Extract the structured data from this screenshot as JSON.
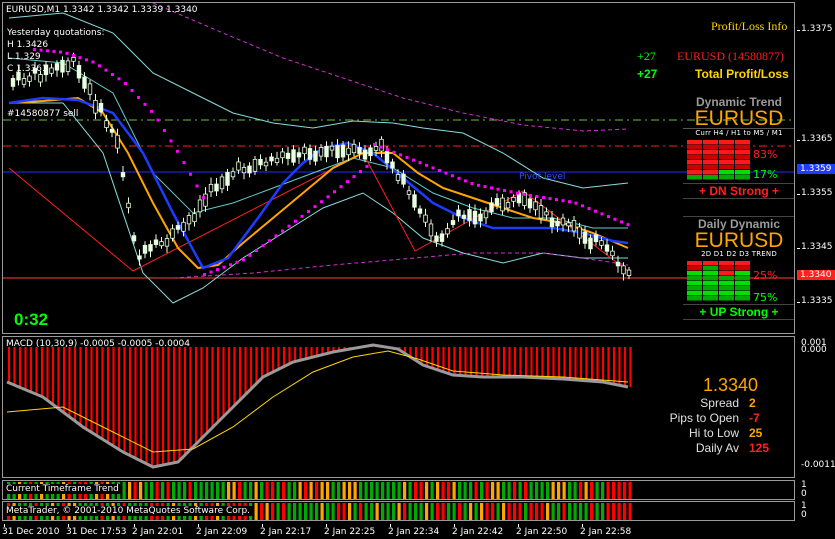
{
  "chart_header": {
    "symbol_line": "EURUSD,M1  1.3342 1.3342 1.3339 1.3340",
    "yesterday_title": "Yesterday quotations:",
    "yesterday_high": "H 1.3426",
    "yesterday_low": "L 1.329",
    "yesterday_close": "C 1.3361",
    "order_label": "#14580877 sell",
    "countdown": "0:32",
    "pivot_label": "Pivot level"
  },
  "profit_loss": {
    "title": "Profit/Loss Info",
    "order_value": "+27",
    "order_label": "EURUSD (14580877)",
    "total_value": "+27",
    "total_label": "Total Profit/Loss"
  },
  "dynamic_trend": {
    "title": "Dynamic Trend",
    "symbol": "EURUSD",
    "columns": "Curr  H4 / H1  to  M5 / M1",
    "down_pct": "83%",
    "up_pct": "17%",
    "signal": "+  DN Strong  +",
    "bar_colors": [
      "#cc0000",
      "#ff0000",
      "#00aa00",
      "#00ff00"
    ]
  },
  "daily_dynamic": {
    "title": "Daily Dynamic",
    "symbol": "EURUSD",
    "columns": "2D  D1  D2  D3  TREND",
    "down_pct": "25%",
    "up_pct": "75%",
    "signal": "+  UP Strong  +"
  },
  "price_axis": {
    "labels": [
      "1.3375",
      "1.3365",
      "1.3355",
      "1.3345",
      "1.3335"
    ],
    "tag_blue": "1.3359",
    "tag_red": "1.3340"
  },
  "macd": {
    "label": "MACD (10,30,9) -0.0005 -0.0005 -0.0004",
    "axis_top": "0.001",
    "axis_zero": "0.000",
    "axis_bottom": "-0.0011"
  },
  "stats": {
    "price": "1.3340",
    "spread_label": "Spread",
    "spread_value": "2",
    "pips_label": "Pips to Open",
    "pips_value": "-7",
    "hilo_label": "Hi to Low",
    "hilo_value": "25",
    "daily_label": "Daily Av",
    "daily_value": "125"
  },
  "trend_panels": {
    "current_label": "Current Timeframe Trend",
    "second_label": "MetaTrader, © 2001-2010 MetaQuotes Software Corp.",
    "axis_one": "1",
    "axis_zero": "0"
  },
  "time_axis": [
    "31 Dec 2010",
    "31 Dec 17:53",
    "2 Jan 22:01",
    "2 Jan 22:09",
    "2 Jan 22:17",
    "2 Jan 22:25",
    "2 Jan 22:34",
    "2 Jan 22:42",
    "2 Jan 22:50",
    "2 Jan 22:58"
  ],
  "colors": {
    "bull_candle": "#e8ffe0",
    "parabolic_sar": "#ff00ff",
    "moving_avg_orange": "#ffa500",
    "moving_avg_blue": "#1e3cff",
    "bollinger": "#88dddd",
    "histogram": "#ff0000",
    "trend_green": "#00aa00",
    "trend_red": "#ff0000",
    "trend_orange": "#ffa500"
  }
}
